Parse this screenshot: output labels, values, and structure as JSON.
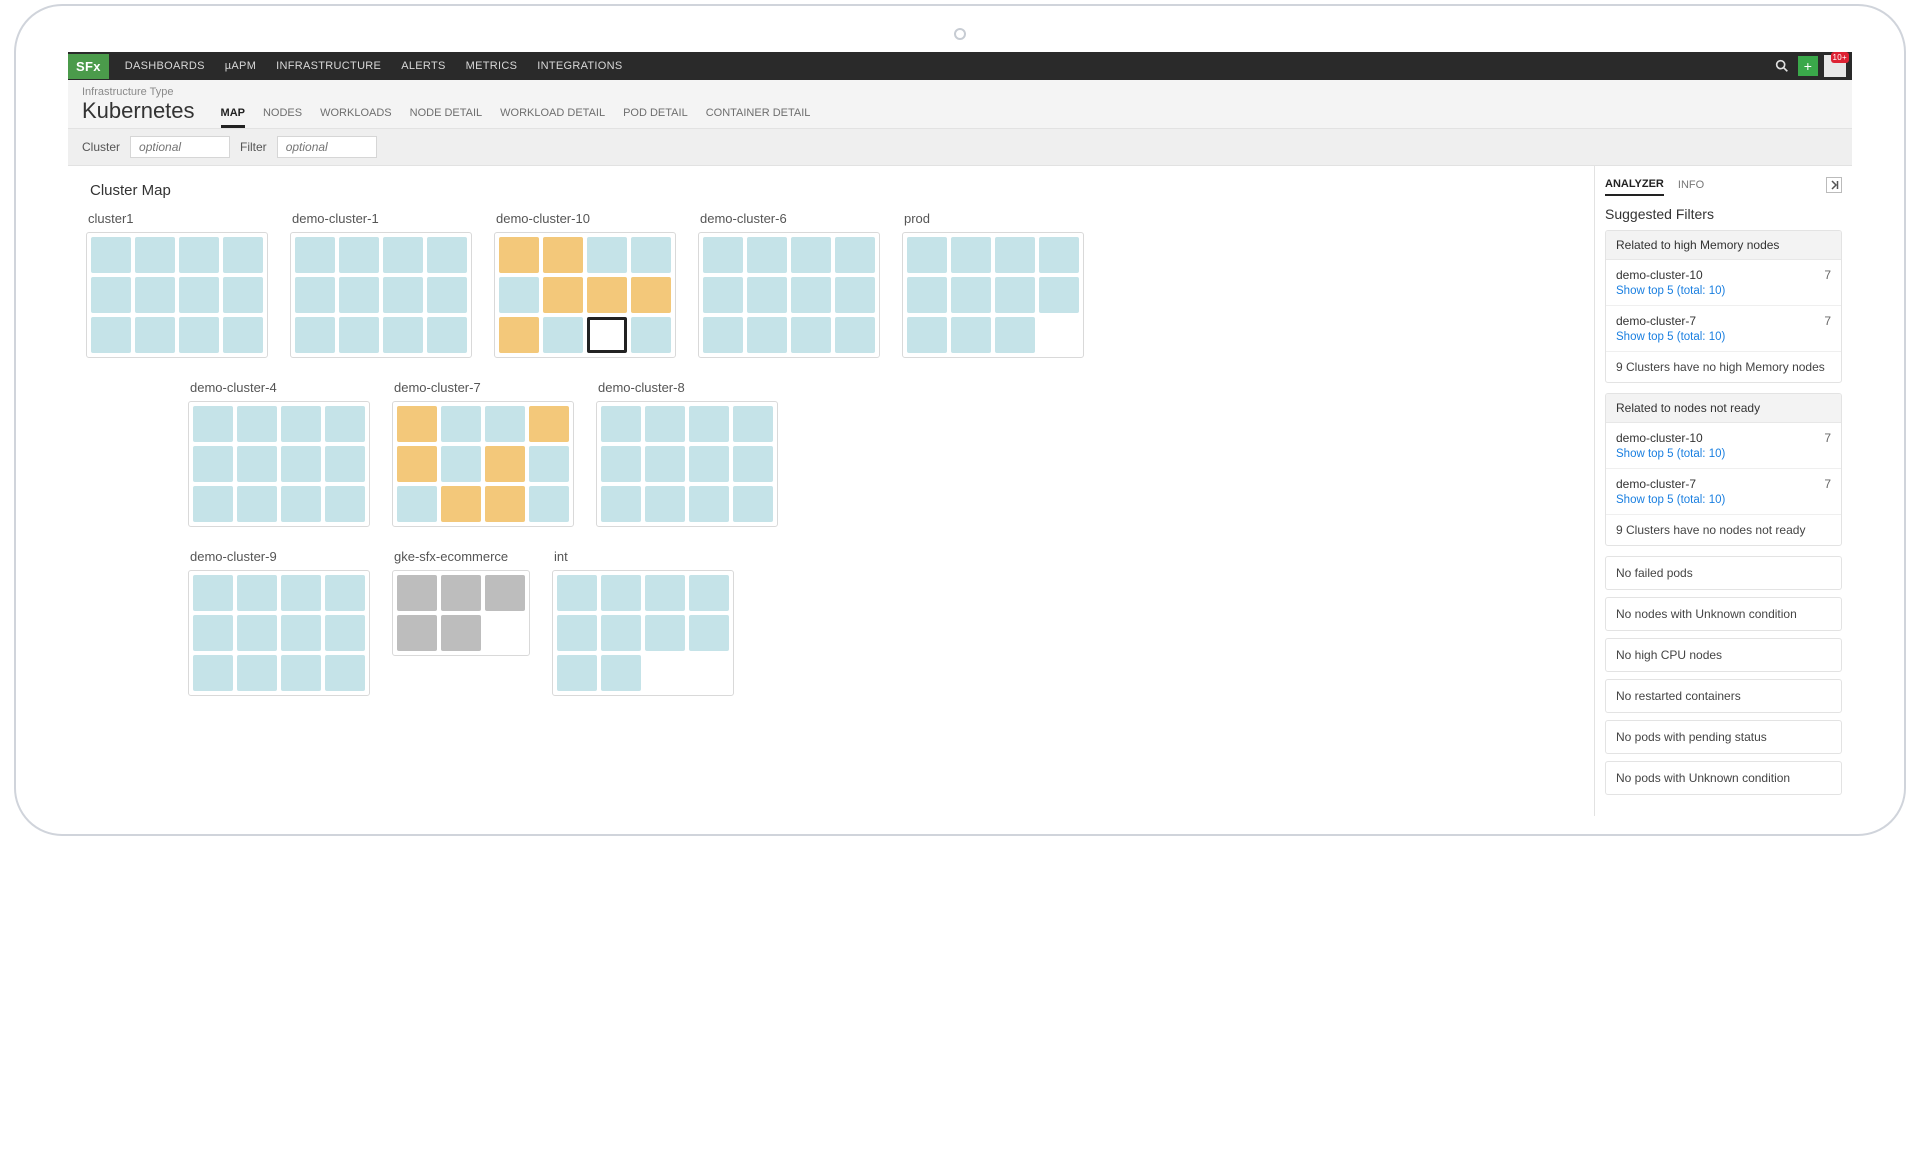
{
  "header": {
    "logo": "SFx",
    "nav": [
      "DASHBOARDS",
      "µAPM",
      "INFRASTRUCTURE",
      "ALERTS",
      "METRICS",
      "INTEGRATIONS"
    ],
    "avatar_badge": "10+"
  },
  "subheader": {
    "type_label": "Infrastructure Type",
    "title": "Kubernetes",
    "tabs": [
      "MAP",
      "NODES",
      "WORKLOADS",
      "NODE DETAIL",
      "WORKLOAD DETAIL",
      "POD DETAIL",
      "CONTAINER DETAIL"
    ],
    "active_tab": "MAP"
  },
  "filters": {
    "cluster_label": "Cluster",
    "cluster_placeholder": "optional",
    "filter_label": "Filter",
    "filter_placeholder": "optional"
  },
  "main": {
    "title": "Cluster Map",
    "clusters": [
      {
        "name": "cluster1",
        "cols": 4,
        "nodes": [
          "b",
          "b",
          "b",
          "b",
          "b",
          "b",
          "b",
          "b",
          "b",
          "b",
          "b",
          "b"
        ]
      },
      {
        "name": "demo-cluster-1",
        "cols": 4,
        "nodes": [
          "b",
          "b",
          "b",
          "b",
          "b",
          "b",
          "b",
          "b",
          "b",
          "b",
          "b",
          "b"
        ]
      },
      {
        "name": "demo-cluster-10",
        "cols": 4,
        "nodes": [
          "o",
          "o",
          "b",
          "b",
          "b",
          "o",
          "o",
          "o",
          "o",
          "b",
          "s",
          "b"
        ]
      },
      {
        "name": "demo-cluster-6",
        "cols": 4,
        "nodes": [
          "b",
          "b",
          "b",
          "b",
          "b",
          "b",
          "b",
          "b",
          "b",
          "b",
          "b",
          "b"
        ]
      },
      {
        "name": "prod",
        "cols": 4,
        "nodes": [
          "b",
          "b",
          "b",
          "b",
          "b",
          "b",
          "b",
          "b",
          "b",
          "b",
          "b",
          "e"
        ]
      },
      {
        "name": "demo-cluster-4",
        "cols": 4,
        "nodes": [
          "b",
          "b",
          "b",
          "b",
          "b",
          "b",
          "b",
          "b",
          "b",
          "b",
          "b",
          "b"
        ]
      },
      {
        "name": "demo-cluster-7",
        "cols": 4,
        "nodes": [
          "o",
          "b",
          "b",
          "o",
          "o",
          "b",
          "o",
          "b",
          "b",
          "o",
          "o",
          "b"
        ]
      },
      {
        "name": "demo-cluster-8",
        "cols": 4,
        "nodes": [
          "b",
          "b",
          "b",
          "b",
          "b",
          "b",
          "b",
          "b",
          "b",
          "b",
          "b",
          "b"
        ]
      },
      {
        "name": "demo-cluster-9",
        "cols": 4,
        "nodes": [
          "b",
          "b",
          "b",
          "b",
          "b",
          "b",
          "b",
          "b",
          "b",
          "b",
          "b",
          "b"
        ]
      },
      {
        "name": "gke-sfx-ecommerce",
        "cols": 3,
        "nodes": [
          "g",
          "g",
          "g",
          "g",
          "g",
          "e"
        ]
      },
      {
        "name": "int",
        "cols": 4,
        "nodes": [
          "b",
          "b",
          "b",
          "b",
          "b",
          "b",
          "b",
          "b",
          "b",
          "b",
          "e",
          "e"
        ]
      }
    ],
    "row_layout": [
      [
        0,
        1,
        2,
        3,
        4
      ],
      [
        5,
        6,
        7
      ],
      [
        8,
        9,
        10
      ]
    ],
    "row_leading_spacer": [
      0,
      80,
      80
    ]
  },
  "sidebar": {
    "tabs": [
      "ANALYZER",
      "INFO"
    ],
    "active_tab": "ANALYZER",
    "heading": "Suggested Filters",
    "groups": [
      {
        "title": "Related to high Memory nodes",
        "items": [
          {
            "name": "demo-cluster-10",
            "count": "7",
            "link": "Show top 5 (total: 10)"
          },
          {
            "name": "demo-cluster-7",
            "count": "7",
            "link": "Show top 5 (total: 10)"
          }
        ],
        "note": "9 Clusters have no high Memory nodes"
      },
      {
        "title": "Related to nodes not ready",
        "items": [
          {
            "name": "demo-cluster-10",
            "count": "7",
            "link": "Show top 5 (total: 10)"
          },
          {
            "name": "demo-cluster-7",
            "count": "7",
            "link": "Show top 5 (total: 10)"
          }
        ],
        "note": "9 Clusters have no nodes not ready"
      }
    ],
    "simple": [
      "No failed pods",
      "No nodes with Unknown condition",
      "No high CPU nodes",
      "No restarted containers",
      "No pods with pending status",
      "No pods with Unknown condition"
    ]
  }
}
